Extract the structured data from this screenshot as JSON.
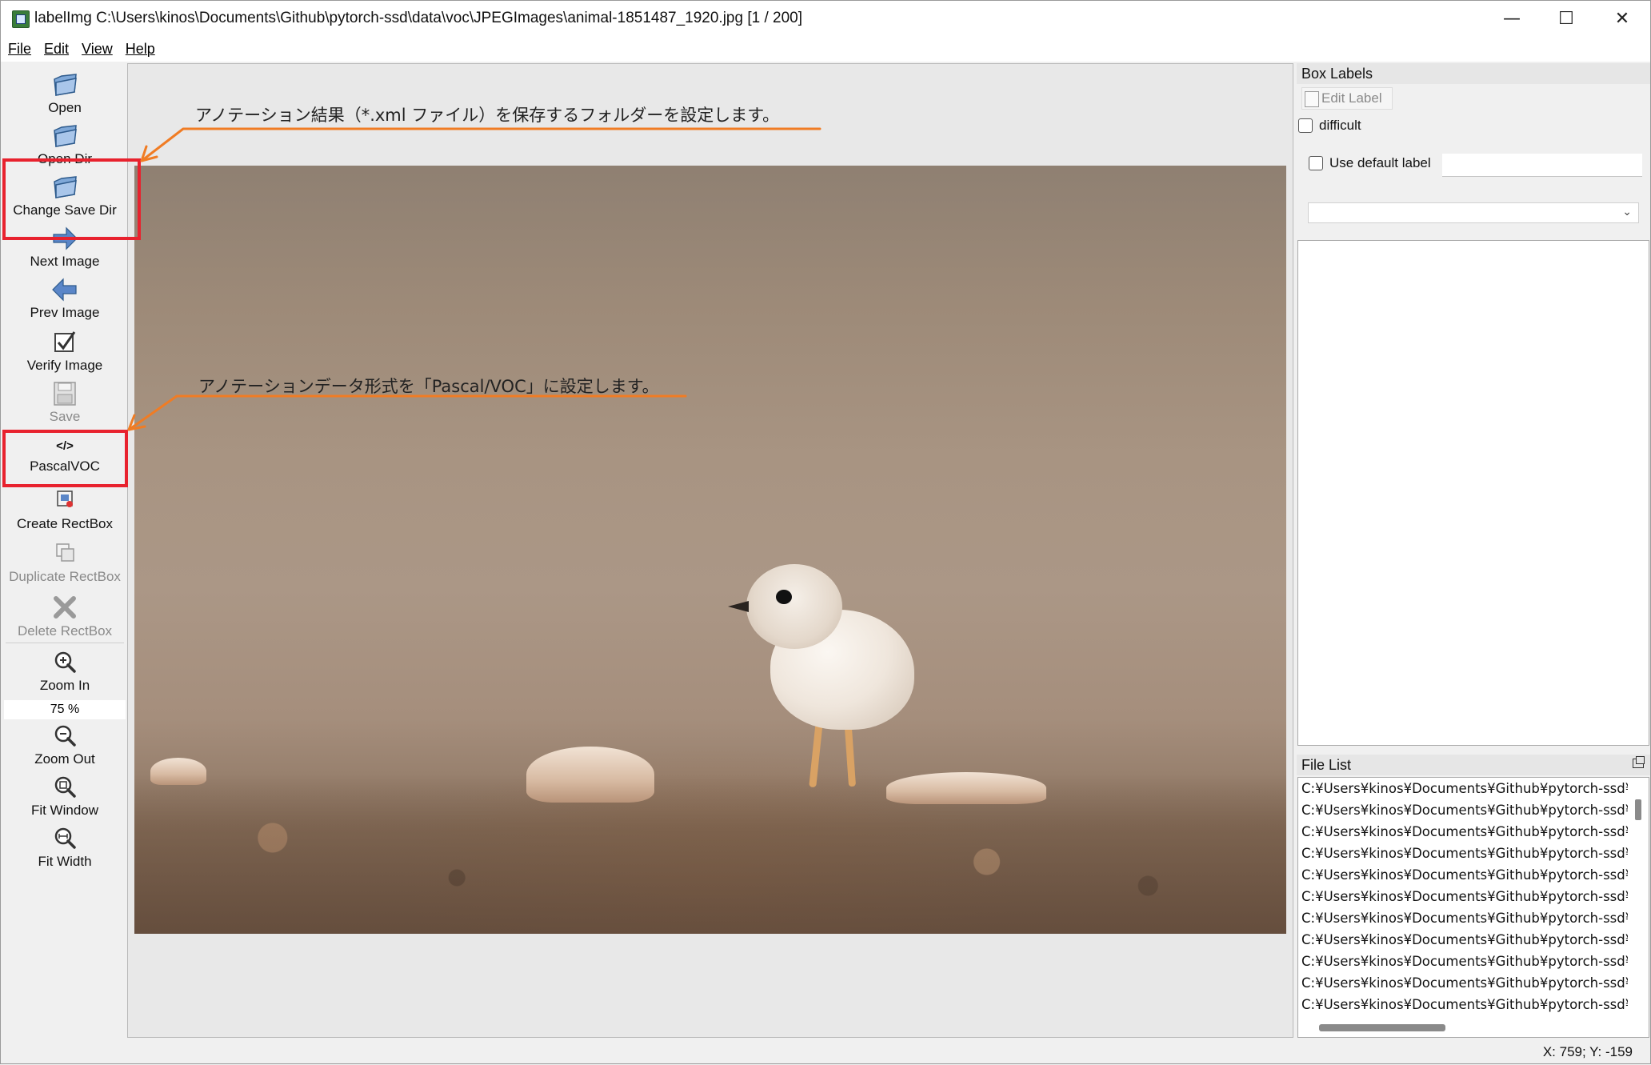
{
  "window": {
    "title": "labelImg C:\\Users\\kinos\\Documents\\Github\\pytorch-ssd\\data\\voc\\JPEGImages\\animal-1851487_1920.jpg [1 / 200]",
    "minimize": "—",
    "maximize": "☐",
    "close": "✕"
  },
  "menu": {
    "file": "File",
    "edit": "Edit",
    "view": "View",
    "help": "Help"
  },
  "toolbar": {
    "open": "Open",
    "open_dir": "Open Dir",
    "change_save_dir": "Change Save Dir",
    "next_image": "Next Image",
    "prev_image": "Prev Image",
    "verify_image": "Verify Image",
    "save": "Save",
    "format": "PascalVOC",
    "format_icon": "</>",
    "create_rectbox": "Create RectBox",
    "duplicate_rectbox": "Duplicate RectBox",
    "delete_rectbox": "Delete RectBox",
    "zoom_in": "Zoom In",
    "zoom_level": "75 %",
    "zoom_out": "Zoom Out",
    "fit_window": "Fit Window",
    "fit_width": "Fit Width"
  },
  "annotations": {
    "save_dir_note": "アノテーション結果（*.xml ファイル）を保存するフォルダーを設定します。",
    "format_note": "アノテーションデータ形式を「Pascal/VOC」に設定します。",
    "accent_color": "#f07c24",
    "highlight_color": "#e8222e"
  },
  "box_labels": {
    "title": "Box Labels",
    "edit_label": "Edit Label",
    "difficult": "difficult",
    "use_default_label": "Use default label",
    "default_label_value": ""
  },
  "file_list": {
    "title": "File List",
    "items": [
      "C:¥Users¥kinos¥Documents¥Github¥pytorch-ssd¥d",
      "C:¥Users¥kinos¥Documents¥Github¥pytorch-ssd¥d",
      "C:¥Users¥kinos¥Documents¥Github¥pytorch-ssd¥d",
      "C:¥Users¥kinos¥Documents¥Github¥pytorch-ssd¥d",
      "C:¥Users¥kinos¥Documents¥Github¥pytorch-ssd¥d",
      "C:¥Users¥kinos¥Documents¥Github¥pytorch-ssd¥d",
      "C:¥Users¥kinos¥Documents¥Github¥pytorch-ssd¥d",
      "C:¥Users¥kinos¥Documents¥Github¥pytorch-ssd¥d",
      "C:¥Users¥kinos¥Documents¥Github¥pytorch-ssd¥d",
      "C:¥Users¥kinos¥Documents¥Github¥pytorch-ssd¥d",
      "C:¥Users¥kinos¥Documents¥Github¥pytorch-ssd¥d"
    ]
  },
  "status": {
    "coords": "X: 759; Y: -159"
  }
}
